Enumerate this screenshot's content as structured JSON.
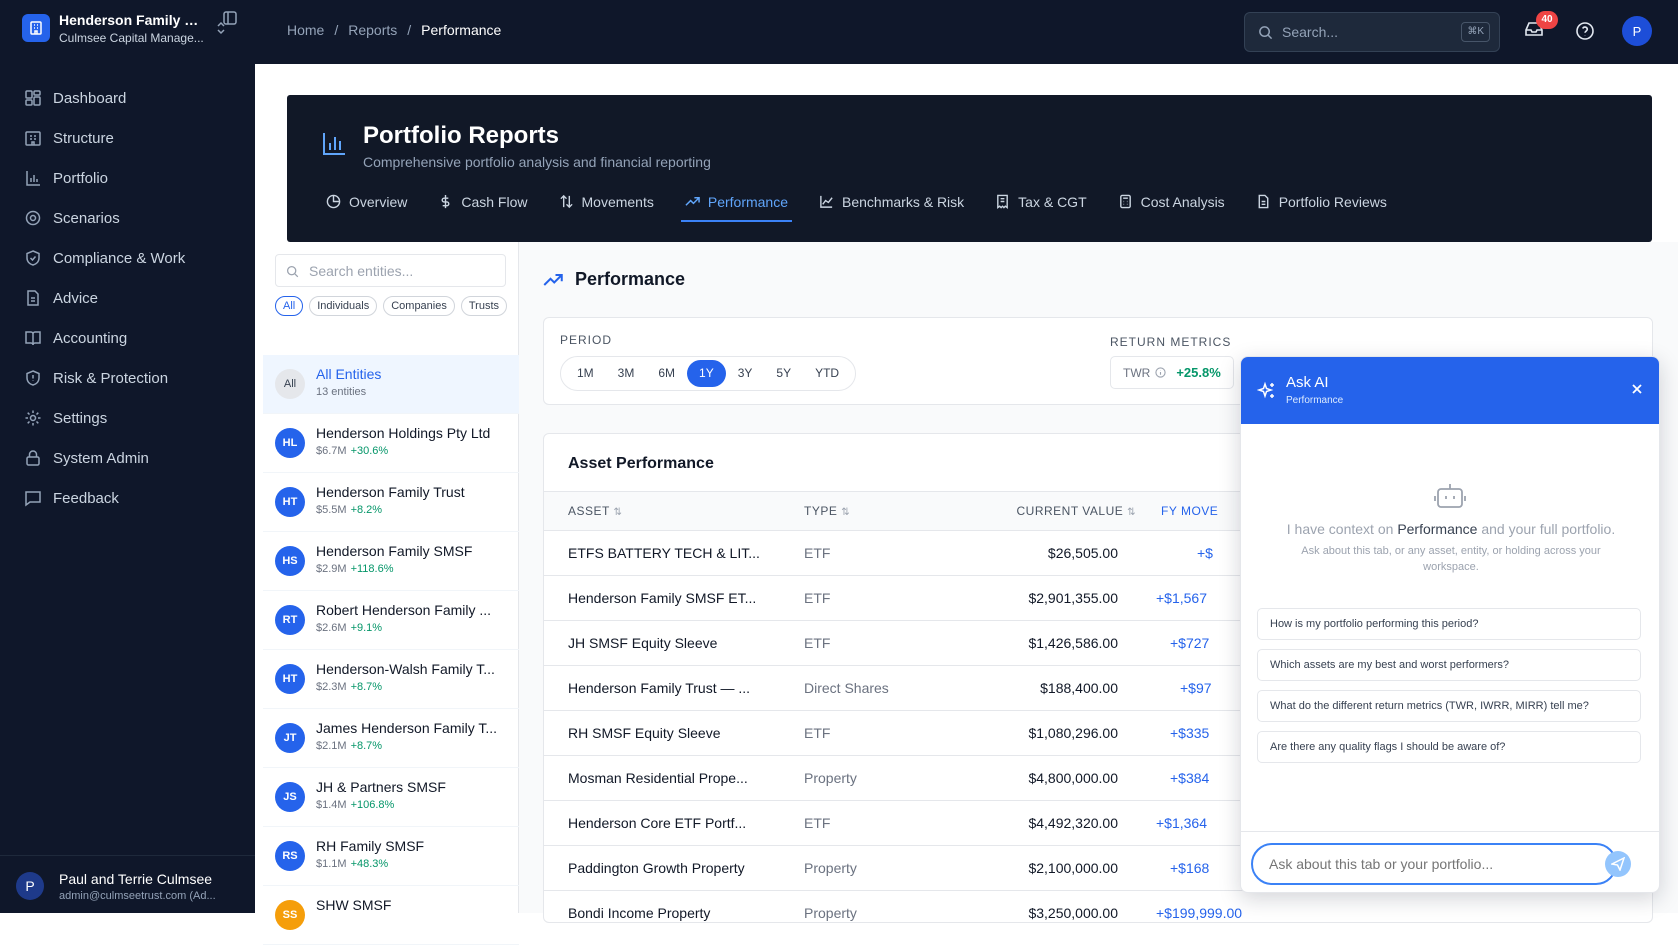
{
  "org": {
    "name": "Henderson Family Of...",
    "sub": "Culmsee Capital Manage..."
  },
  "nav": [
    {
      "label": "Dashboard",
      "icon": "dashboard-icon"
    },
    {
      "label": "Structure",
      "icon": "structure-icon"
    },
    {
      "label": "Portfolio",
      "icon": "portfolio-icon"
    },
    {
      "label": "Scenarios",
      "icon": "scenarios-icon"
    },
    {
      "label": "Compliance & Work",
      "icon": "shield-check-icon"
    },
    {
      "label": "Advice",
      "icon": "advice-icon"
    },
    {
      "label": "Accounting",
      "icon": "book-icon"
    },
    {
      "label": "Risk & Protection",
      "icon": "shield-alert-icon"
    },
    {
      "label": "Settings",
      "icon": "gear-icon"
    },
    {
      "label": "System Admin",
      "icon": "lock-icon"
    },
    {
      "label": "Feedback",
      "icon": "message-icon"
    }
  ],
  "user": {
    "initial": "P",
    "name": "Paul and Terrie Culmsee",
    "email": "admin@culmseetrust.com (Ad..."
  },
  "breadcrumb": {
    "home": "Home",
    "sep": "/",
    "reports": "Reports",
    "current": "Performance"
  },
  "search": {
    "placeholder": "Search...",
    "shortcut": "⌘K"
  },
  "notifications": {
    "count": "40"
  },
  "top_avatar": "P",
  "hero": {
    "title": "Portfolio Reports",
    "subtitle": "Comprehensive portfolio analysis and financial reporting"
  },
  "tabs": [
    {
      "label": "Overview",
      "icon": "pie-chart-icon"
    },
    {
      "label": "Cash Flow",
      "icon": "dollar-icon"
    },
    {
      "label": "Movements",
      "icon": "arrows-updown-icon"
    },
    {
      "label": "Performance",
      "icon": "trending-up-icon",
      "active": true
    },
    {
      "label": "Benchmarks & Risk",
      "icon": "line-chart-icon"
    },
    {
      "label": "Tax & CGT",
      "icon": "receipt-icon"
    },
    {
      "label": "Cost Analysis",
      "icon": "calculator-icon"
    },
    {
      "label": "Portfolio Reviews",
      "icon": "file-text-icon"
    }
  ],
  "entities": {
    "search_placeholder": "Search entities...",
    "filters": [
      "All",
      "Individuals",
      "Companies",
      "Trusts"
    ],
    "active_filter": "All",
    "items": [
      {
        "initials": "All",
        "name": "All Entities",
        "value": "13 entities",
        "change": ""
      },
      {
        "initials": "HL",
        "name": "Henderson Holdings Pty Ltd",
        "value": "$6.7M",
        "change": "+30.6%"
      },
      {
        "initials": "HT",
        "name": "Henderson Family Trust",
        "value": "$5.5M",
        "change": "+8.2%"
      },
      {
        "initials": "HS",
        "name": "Henderson Family SMSF",
        "value": "$2.9M",
        "change": "+118.6%"
      },
      {
        "initials": "RT",
        "name": "Robert Henderson Family ...",
        "value": "$2.6M",
        "change": "+9.1%"
      },
      {
        "initials": "HT",
        "name": "Henderson-Walsh Family T...",
        "value": "$2.3M",
        "change": "+8.7%"
      },
      {
        "initials": "JT",
        "name": "James Henderson Family T...",
        "value": "$2.1M",
        "change": "+8.7%"
      },
      {
        "initials": "JS",
        "name": "JH & Partners SMSF",
        "value": "$1.4M",
        "change": "+106.8%"
      },
      {
        "initials": "RS",
        "name": "RH Family SMSF",
        "value": "$1.1M",
        "change": "+48.3%"
      },
      {
        "initials": "SS",
        "name": "SHW SMSF",
        "value": "",
        "change": ""
      }
    ]
  },
  "performance": {
    "title": "Performance",
    "period_label": "PERIOD",
    "periods": [
      "1M",
      "3M",
      "6M",
      "1Y",
      "3Y",
      "5Y",
      "YTD"
    ],
    "active_period": "1Y",
    "metrics_label": "RETURN METRICS",
    "twr_label": "TWR",
    "twr_value": "+25.8%"
  },
  "asset_table": {
    "title": "Asset Performance",
    "columns": [
      "ASSET",
      "TYPE",
      "CURRENT VALUE",
      "FY MOVE"
    ],
    "rows": [
      {
        "asset": "ETFS BATTERY TECH & LIT...",
        "type": "ETF",
        "value": "$26,505.00",
        "fy": "+$"
      },
      {
        "asset": "Henderson Family SMSF ET...",
        "type": "ETF",
        "value": "$2,901,355.00",
        "fy": "+$1,567"
      },
      {
        "asset": "JH SMSF Equity Sleeve",
        "type": "ETF",
        "value": "$1,426,586.00",
        "fy": "+$727"
      },
      {
        "asset": "Henderson Family Trust — ...",
        "type": "Direct Shares",
        "value": "$188,400.00",
        "fy": "+$97"
      },
      {
        "asset": "RH SMSF Equity Sleeve",
        "type": "ETF",
        "value": "$1,080,296.00",
        "fy": "+$335"
      },
      {
        "asset": "Mosman Residential Prope...",
        "type": "Property",
        "value": "$4,800,000.00",
        "fy": "+$384"
      },
      {
        "asset": "Henderson Core ETF Portf...",
        "type": "ETF",
        "value": "$4,492,320.00",
        "fy": "+$1,364"
      },
      {
        "asset": "Paddington Growth Property",
        "type": "Property",
        "value": "$2,100,000.00",
        "fy": "+$168"
      },
      {
        "asset": "Bondi Income Property",
        "type": "Property",
        "value": "$3,250,000.00",
        "fy": "+$199,999.00"
      }
    ]
  },
  "ai": {
    "title": "Ask AI",
    "context": "Performance",
    "intro_prefix": "I have context on",
    "intro_focus": "Performance",
    "intro_suffix": "and your full portfolio.",
    "intro_detail": "Ask about this tab, or any asset, entity, or holding across your workspace.",
    "suggestions": [
      "How is my portfolio performing this period?",
      "Which assets are my best and worst performers?",
      "What do the different return metrics (TWR, IWRR, MIRR) tell me?",
      "Are there any quality flags I should be aware of?"
    ],
    "input_placeholder": "Ask about this tab or your portfolio..."
  },
  "colors": {
    "sidebar": "#0f172a",
    "accent": "#2563eb",
    "positive": "#059669"
  }
}
